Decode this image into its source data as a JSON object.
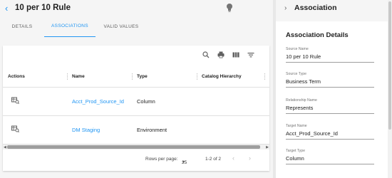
{
  "header": {
    "back_icon": "chevron-left-icon",
    "title": "10 per 10 Rule",
    "bulb_icon": "lightbulb-icon"
  },
  "tabs": [
    {
      "label": "DETAILS"
    },
    {
      "label": "ASSOCIATIONS",
      "active": true
    },
    {
      "label": "VALID VALUES"
    }
  ],
  "toolbar": {
    "icons": [
      "search-icon",
      "print-icon",
      "columns-icon",
      "filter-icon"
    ]
  },
  "table": {
    "columns": [
      "Actions",
      "Name",
      "Type",
      "Catalog Hierarchy"
    ],
    "rows": [
      {
        "name": "Acct_Prod_Source_Id",
        "type": "Column"
      },
      {
        "name": "DM Staging",
        "type": "Environment"
      }
    ]
  },
  "pager": {
    "rows_label": "Rows per page:",
    "rows_value": "25",
    "range": "1-2 of 2"
  },
  "panel": {
    "title": "Association",
    "section_title": "Association Details",
    "fields": [
      {
        "label": "Source Name",
        "value": "10 per 10 Rule"
      },
      {
        "label": "Source Type",
        "value": "Business Term"
      },
      {
        "label": "Relationship Name",
        "value": "Represents"
      },
      {
        "label": "Target Name",
        "value": "Acct_Prod_Source_Id"
      },
      {
        "label": "Target Type",
        "value": "Column"
      }
    ]
  },
  "colors": {
    "accent": "#2196f3"
  }
}
